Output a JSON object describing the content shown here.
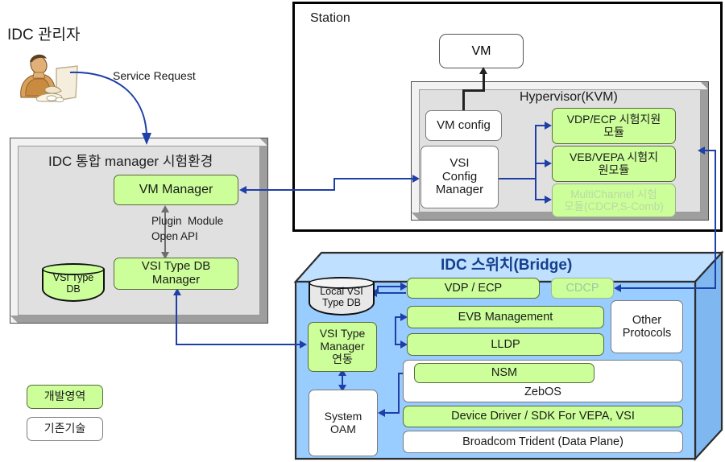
{
  "diagram": {
    "title_actor": "IDC 관리자",
    "service_request_label": "Service Request",
    "manager_panel": {
      "title": "IDC 통합 manager 시험환경",
      "vm_manager": "VM Manager",
      "plugin_label_line1": "Plugin  Module",
      "plugin_label_line2": "Open API",
      "vsi_type_db_manager_line1": "VSI Type DB",
      "vsi_type_db_manager_line2": "Manager",
      "vsi_type_db_line1": "VSI Type",
      "vsi_type_db_line2": "DB"
    },
    "station": {
      "title": "Station",
      "vm_label": "VM",
      "hypervisor_title": "Hypervisor(KVM)",
      "vm_config": "VM config",
      "vsi_config_manager_line1": "VSI",
      "vsi_config_manager_line2": "Config",
      "vsi_config_manager_line3": "Manager",
      "modules": [
        {
          "line1": "VDP/ECP 시험지원",
          "line2": "모듈",
          "faded": false
        },
        {
          "line1": "VEB/VEPA  시험지",
          "line2": "원모듈",
          "faded": false
        },
        {
          "line1": "MultiChannel 시험",
          "line2": "모듈(CDCP,S-Comb)",
          "faded": true
        }
      ]
    },
    "bridge": {
      "title": "IDC 스위치(Bridge)",
      "local_vsi_type_db_line1": "Local  VSI",
      "local_vsi_type_db_line2": "Type DB",
      "vsi_type_manager_line1": "VSI Type",
      "vsi_type_manager_line2": "Manager",
      "vsi_type_manager_line3": "연동",
      "system_oam_line1": "System",
      "system_oam_line2": "OAM",
      "vdp_ecp": "VDP / ECP",
      "cdcp": "CDCP",
      "evb_management": "EVB Management",
      "lldp": "LLDP",
      "nsm": "NSM",
      "zebos": "ZebOS",
      "other_protocols_line1": "Other",
      "other_protocols_line2": "Protocols",
      "device_driver": "Device Driver / SDK For VEPA, VSI",
      "data_plane": "Broadcom Trident (Data Plane)"
    },
    "legend": [
      {
        "label": "개발영역",
        "kind": "green"
      },
      {
        "label": "기존기술",
        "kind": "white"
      }
    ],
    "colors": {
      "green": "#ccff99",
      "blue_panel": "#99ccff",
      "grey_panel": "#e0e0e0",
      "arrow_blue": "#1f3fa8",
      "bridge_title": "#153e8c"
    }
  }
}
